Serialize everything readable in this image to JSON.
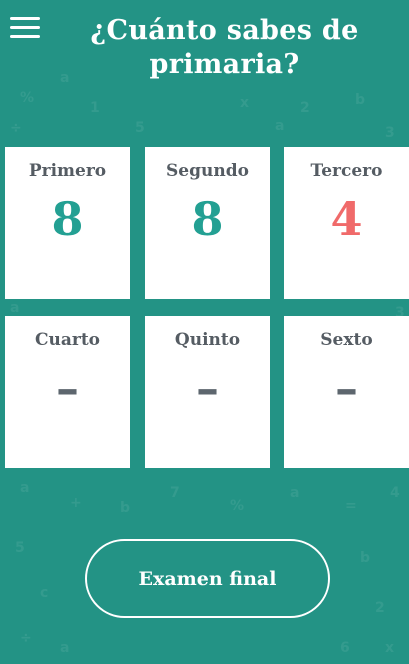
{
  "header": {
    "title_line1": "¿Cuánto sabes de",
    "title_line2": "primaria?"
  },
  "grades": [
    {
      "label": "Primero",
      "score": "8",
      "status": "ok"
    },
    {
      "label": "Segundo",
      "score": "8",
      "status": "ok"
    },
    {
      "label": "Tercero",
      "score": "4",
      "status": "bad"
    },
    {
      "label": "Cuarto",
      "score": "–",
      "status": "empty"
    },
    {
      "label": "Quinto",
      "score": "–",
      "status": "empty"
    },
    {
      "label": "Sexto",
      "score": "–",
      "status": "empty"
    }
  ],
  "exam_button": {
    "label": "Examen final"
  },
  "colors": {
    "background": "#239385",
    "score_ok": "#23a093",
    "score_bad": "#f06a6a",
    "score_empty": "#5d666e"
  },
  "icons": {
    "menu": "hamburger-menu-icon"
  }
}
